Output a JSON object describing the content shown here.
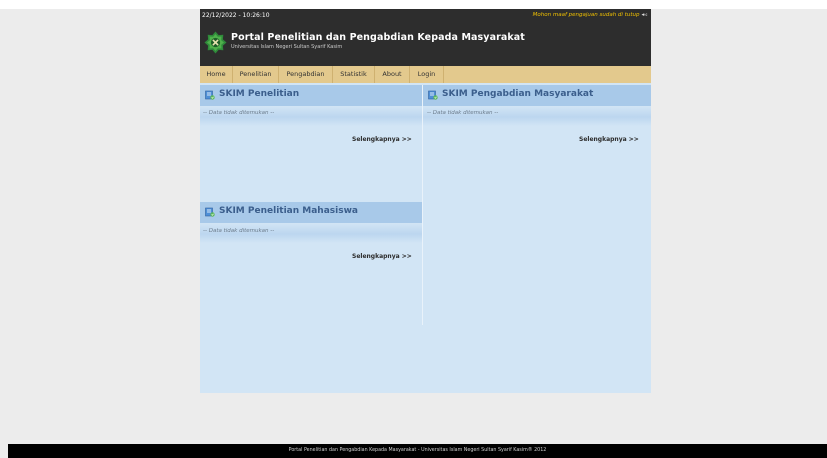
{
  "header": {
    "datetime": "22/12/2022 - 10:26:10",
    "notice": "Mohon maaf pengajuan sudah di tutup",
    "title": "Portal Penelitian dan Pengabdian Kepada Masyarakat",
    "subtitle": "Universitas Islam Negeri Sultan Syarif Kasim"
  },
  "nav": {
    "items": [
      {
        "label": "Home"
      },
      {
        "label": "Penelitian"
      },
      {
        "label": "Pengabdian"
      },
      {
        "label": "Statistik"
      },
      {
        "label": "About"
      },
      {
        "label": "Login"
      }
    ]
  },
  "panels": {
    "penelitian": {
      "title": "SKIM Penelitian",
      "empty_text": "-- Data tidak ditemukan --",
      "more_label": "Selengkapnya >>"
    },
    "pengabdian": {
      "title": "SKIM Pengabdian Masyarakat",
      "empty_text": "-- Data tidak ditemukan --",
      "more_label": "Selengkapnya >>"
    },
    "mahasiswa": {
      "title": "SKIM Penelitian Mahasiswa",
      "empty_text": "-- Data tidak ditemukan --",
      "more_label": "Selengkapnya >>"
    }
  },
  "footer": {
    "text": "Portal Penelitian dan Pengabdian Kepada Masyarakat - Universitas Islam Negeri Sultan Syarif Kasim® 2012"
  },
  "colors": {
    "header_bg": "#2d2d2d",
    "nav_bg": "#e3c98d",
    "content_bg": "#d2e5f5",
    "panel_header_bg": "#a8c9e9",
    "panel_title": "#3b5e8c",
    "notice": "#f0c000"
  }
}
